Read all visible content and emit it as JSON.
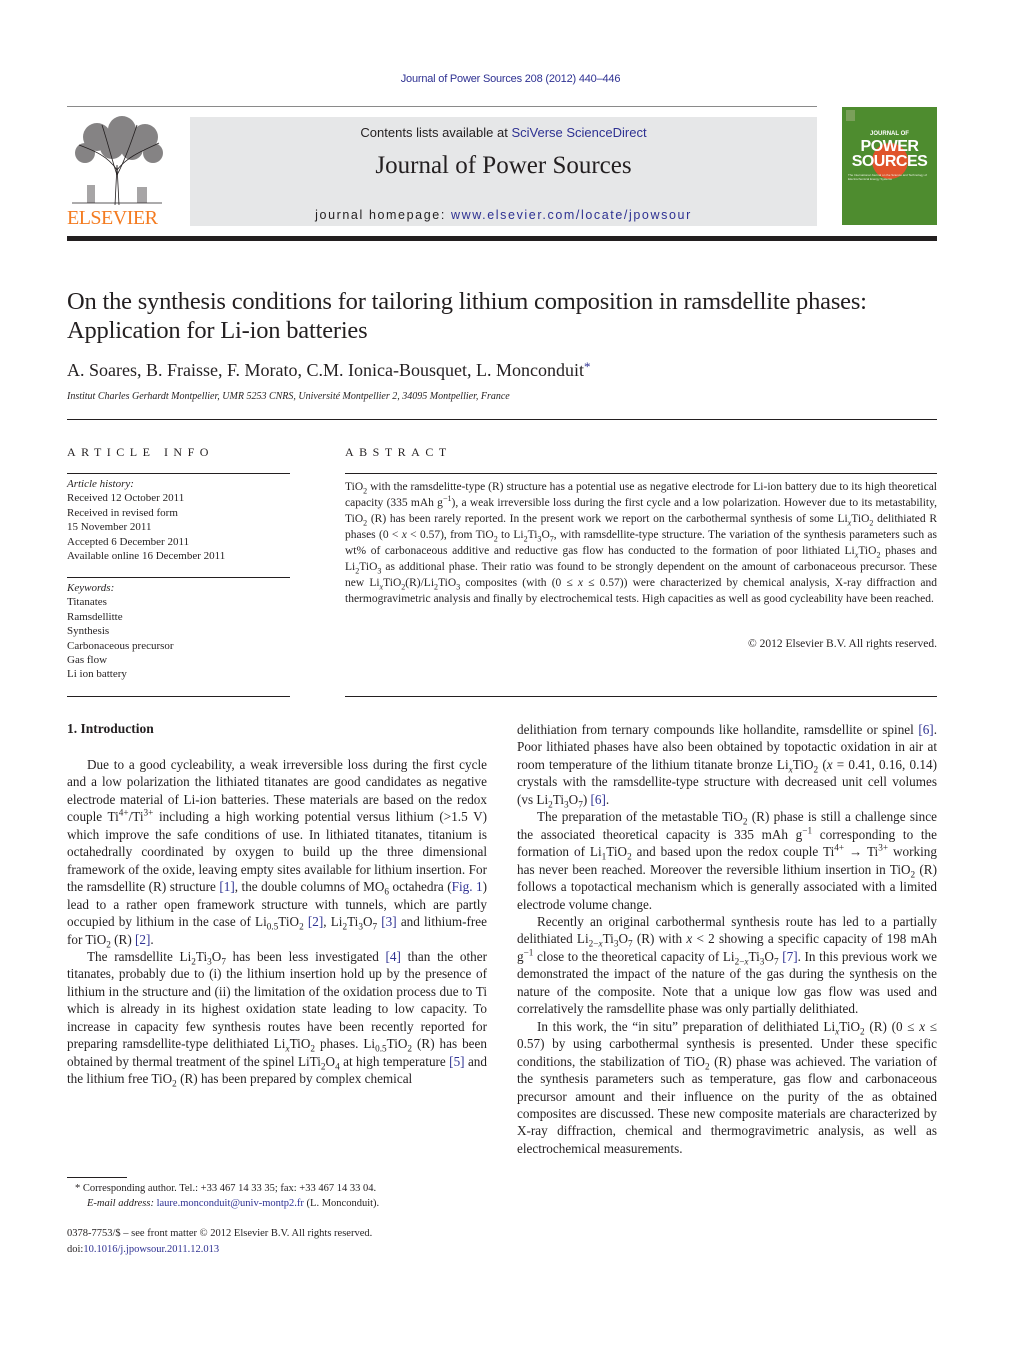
{
  "header": {
    "citation": "Journal of Power Sources 208 (2012) 440–446",
    "contents_prefix": "Contents lists available at ",
    "contents_link": "SciVerse ScienceDirect",
    "journal_name": "Journal of Power Sources",
    "homepage_prefix": "journal homepage: ",
    "homepage_url": "www.elsevier.com/locate/jpowsour",
    "publisher_logo_text": "ELSEVIER",
    "cover": {
      "line1": "JOURNAL OF",
      "line2": "POWER",
      "line3": "SOURCES",
      "tagline": "The International Journal on the Science and Technology of Electrochemical Energy Systems"
    },
    "colors": {
      "link": "#2e3192",
      "elsevier_orange": "#f47b20",
      "masthead_bg": "#e6e7e8",
      "cover_green": "#4e8c2f"
    }
  },
  "article": {
    "title": "On the synthesis conditions for tailoring lithium composition in ramsdellite phases: Application for Li-ion batteries",
    "authors": "A. Soares, B. Fraisse, F. Morato, C.M. Ionica-Bousquet, L. Monconduit",
    "corresponding_mark": "*",
    "affiliation": "Institut Charles Gerhardt Montpellier, UMR 5253 CNRS, Université Montpellier 2, 34095 Montpellier, France"
  },
  "article_info": {
    "label": "ARTICLE INFO",
    "history_heading": "Article history:",
    "history": [
      "Received 12 October 2011",
      "Received in revised form",
      "15 November 2011",
      "Accepted 6 December 2011",
      "Available online 16 December 2011"
    ],
    "keywords_heading": "Keywords:",
    "keywords": [
      "Titanates",
      "Ramsdellitte",
      "Synthesis",
      "Carbonaceous precursor",
      "Gas flow",
      "Li ion battery"
    ]
  },
  "abstract": {
    "label": "ABSTRACT",
    "copyright": "© 2012 Elsevier B.V. All rights reserved.",
    "t": [
      "with the ramsdelitte-type (R) structure has a potential use as negative electrode for Li-ion battery due to its high theoretical capacity (335 mAh g",
      "), a weak irreversible loss during the first cycle and a low polarization. However due to its metastability, TiO",
      " (R) has been rarely reported. In the present work we report on the carbothermal synthesis of some Li",
      "TiO",
      " delithiated R phases (0 < ",
      " < 0.57), from TiO",
      " to Li",
      "Ti",
      "O",
      ", with ramsdellite-type structure. The variation of the synthesis parameters such as wt% of carbonaceous additive and reductive gas flow has conducted to the formation of poor lithiated Li",
      " phases and Li",
      " as additional phase. Their ratio was found to be strongly dependent on the amount of carbonaceous precursor. These new Li",
      "(R)/Li",
      " composites (with (0 ≤ ",
      " ≤ 0.57)) were characterized by chemical analysis, X-ray diffraction and thermogravimetric analysis and finally by electrochemical tests. High capacities as well as good cycleability have been reached."
    ]
  },
  "introduction": {
    "heading": "1.  Introduction",
    "p1": [
      "Due to a good cycleability, a weak irreversible loss during the first cycle and a low polarization the lithiated titanates are good candidates as negative electrode material of Li-ion batteries. These materials are based on the redox couple Ti",
      "/Ti",
      " including a high working potential versus lithium (>1.5 V) which improve the safe conditions of use. In lithiated titanates, titanium is octahedrally coordinated by oxygen to build up the three dimensional framework of the oxide, leaving empty sites available for lithium insertion. For the ramsdellite (R) structure ",
      ", the double columns of MO",
      " octahedra (",
      ") lead to a rather open framework structure with tunnels, which are partly occupied by lithium in the case of Li",
      "TiO",
      " and lithium-free for TiO",
      " (R) "
    ],
    "p2": [
      "The ramsdellite Li",
      " has been less investigated ",
      " than the other titanates, probably due to (i) the lithium insertion hold up by the presence of lithium in the structure and (ii) the limitation of the oxidation process due to Ti which is already in its highest oxidation state leading to low capacity. To increase in capacity few synthesis routes have been recently reported for preparing ramsdellite-type delithiated Li",
      " phases. Li",
      " (R) has been obtained by thermal treatment of the spinel LiTi",
      " at high temperature ",
      " and the lithium free TiO",
      " (R) has been prepared by complex chemical delithiation from ternary compounds like hollandite, ramsdellite or spinel ",
      ". Poor lithiated phases have also been obtained by topotactic oxidation in air at room temperature of the lithium titanate bronze Li",
      " (",
      " = 0.41, 0.16, 0.14) crystals with the ramsdellite-type structure with decreased unit cell volumes (vs Li",
      ") "
    ],
    "p3": [
      "The preparation of the metastable TiO",
      " (R) phase is still a challenge since the associated theoretical capacity is 335 mAh g",
      " corresponding to the formation of Li",
      " and based upon the redox couple Ti",
      " → Ti",
      " working has never been reached. Moreover the reversible lithium insertion in TiO",
      " (R) follows a topotactical mechanism which is generally associated with a limited electrode volume change."
    ],
    "p4": [
      "Recently an original carbothermal synthesis route has led to a partially delithiated Li",
      " (R) with ",
      " < 2 showing a specific capacity of 198 mAh g",
      " close to the theoretical capacity of Li",
      ". In this previous work we demonstrated the impact of the nature of the gas during the synthesis on the nature of the composite. Note that a unique low gas flow was used and correlatively the ramsdellite phase was only partially delithiated."
    ],
    "p5": [
      "In this work, the “in situ” preparation of delithiated Li",
      " (R) (0 ≤ ",
      " ≤ 0.57) by using carbothermal synthesis is presented. Under these specific conditions, the stabilization of TiO",
      " (R) phase was achieved. The variation of the synthesis parameters such as temperature, gas flow and carbonaceous precursor amount and their influence on the purity of the as obtained composites are discussed. These new composite materials are characterized by X-ray diffraction, chemical and thermogravimetric analysis, as well as electrochemical measurements."
    ],
    "refs": {
      "r1": "[1]",
      "r2": "[2]",
      "r3": "[3]",
      "r4": "[4]",
      "r5": "[5]",
      "r6": "[6]",
      "r7": "[7]",
      "fig1": "Fig. 1"
    }
  },
  "footnotes": {
    "corresponding": "Corresponding author. Tel.: +33 467 14 33 35; fax: +33 467 14 33 04.",
    "email_label": "E-mail address:",
    "email": "laure.monconduit@univ-montp2.fr",
    "email_suffix": " (L. Monconduit).",
    "front_matter": "0378-7753/$ – see front matter © 2012 Elsevier B.V. All rights reserved.",
    "doi_prefix": "doi:",
    "doi": "10.1016/j.jpowsour.2011.12.013"
  }
}
